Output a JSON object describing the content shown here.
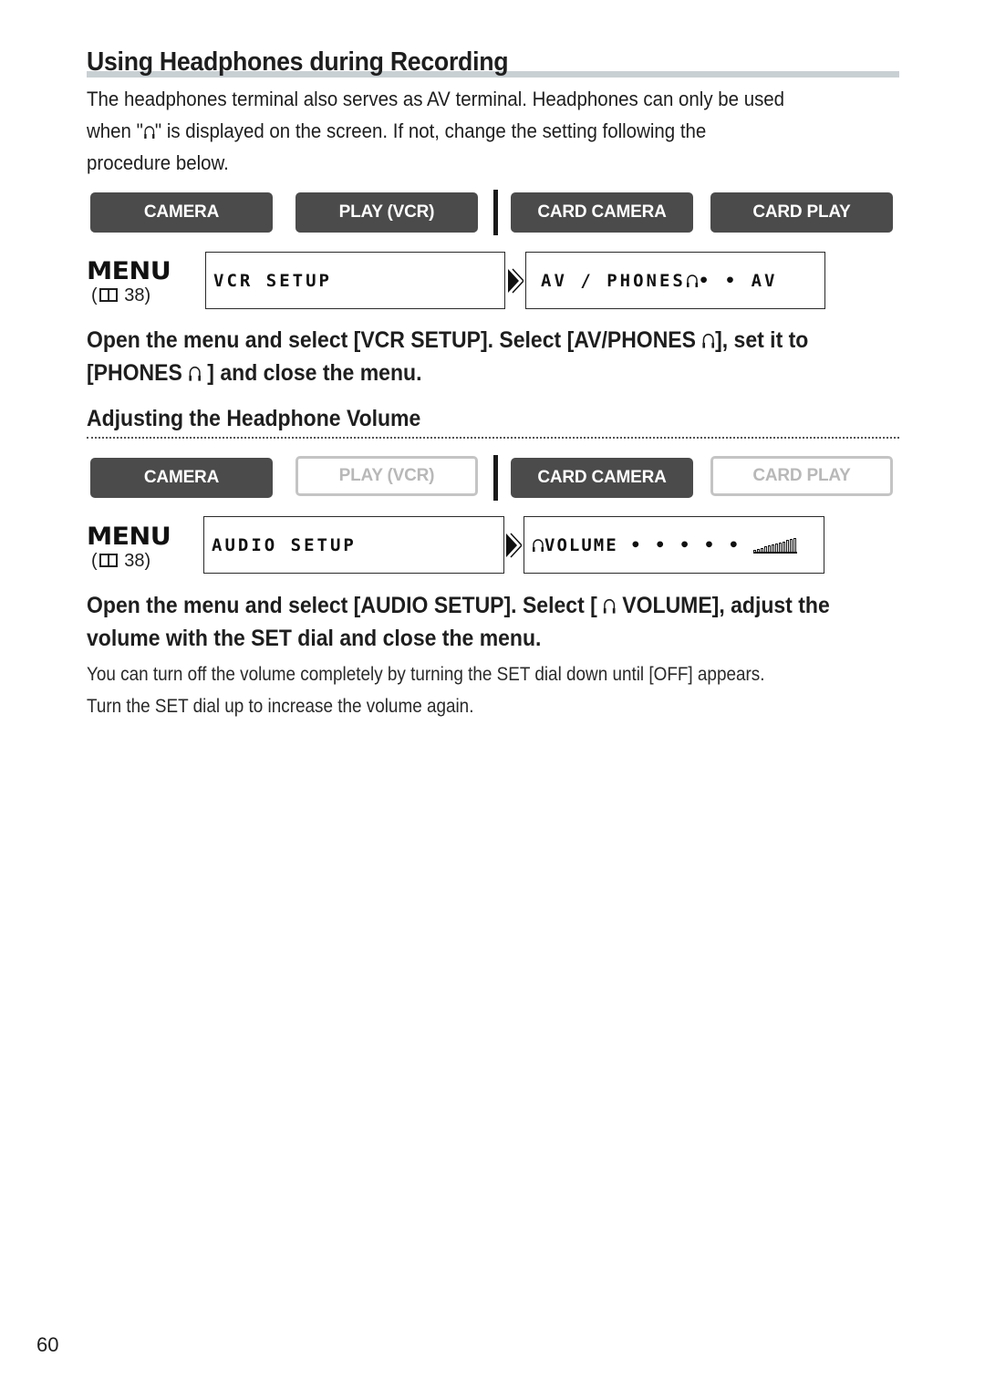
{
  "page": {
    "title": "Using Headphones during Recording",
    "intro": {
      "line1": "The headphones terminal also serves as AV terminal. Headphones can only be used",
      "line2_a": "when \"",
      "line2_b": "\" is displayed on the screen. If not, change the setting following the",
      "line3": "procedure below."
    },
    "section1": {
      "modes": [
        {
          "label": "CAMERA",
          "active": true
        },
        {
          "label": "PLAY (VCR)",
          "active": true
        },
        {
          "label": "CARD CAMERA",
          "active": true
        },
        {
          "label": "CARD PLAY",
          "active": true
        }
      ],
      "menu_label": "MENU",
      "menu_ref_open": "(",
      "menu_ref_page": " 38)",
      "lcd_left": "VCR SETUP",
      "lcd_right_a": "AV / PHONES ",
      "lcd_right_b": " • • AV",
      "instruction_line1_a": "Open the menu and select [VCR SETUP]. Select [AV/PHONES ",
      "instruction_line1_b": "], set it to",
      "instruction_line2_a": "[PHONES ",
      "instruction_line2_b": " ] and close the menu."
    },
    "section2": {
      "heading": "Adjusting the Headphone Volume",
      "modes": [
        {
          "label": "CAMERA",
          "active": true
        },
        {
          "label": "PLAY (VCR)",
          "active": false
        },
        {
          "label": "CARD CAMERA",
          "active": true
        },
        {
          "label": "CARD PLAY",
          "active": false
        }
      ],
      "menu_label": "MENU",
      "menu_ref_open": "(",
      "menu_ref_page": " 38)",
      "lcd_left": "AUDIO SETUP",
      "lcd_right": "VOLUME • • • • •",
      "volume_level": "12/12",
      "instruction_line1_a": "Open the menu and select [AUDIO SETUP]. Select [ ",
      "instruction_line1_b": " VOLUME], adjust the",
      "instruction_line2": "volume with the SET dial and close the menu.",
      "note_line1": "You can turn off the volume completely by turning the SET dial down until [OFF] appears.",
      "note_line2": "Turn the SET dial up to increase the volume again."
    },
    "page_number": "60",
    "colors": {
      "mode_active_bg": "#4b4b4b",
      "mode_inactive_border": "#c4c4c4",
      "title_bar": "#c9d0d3"
    }
  }
}
